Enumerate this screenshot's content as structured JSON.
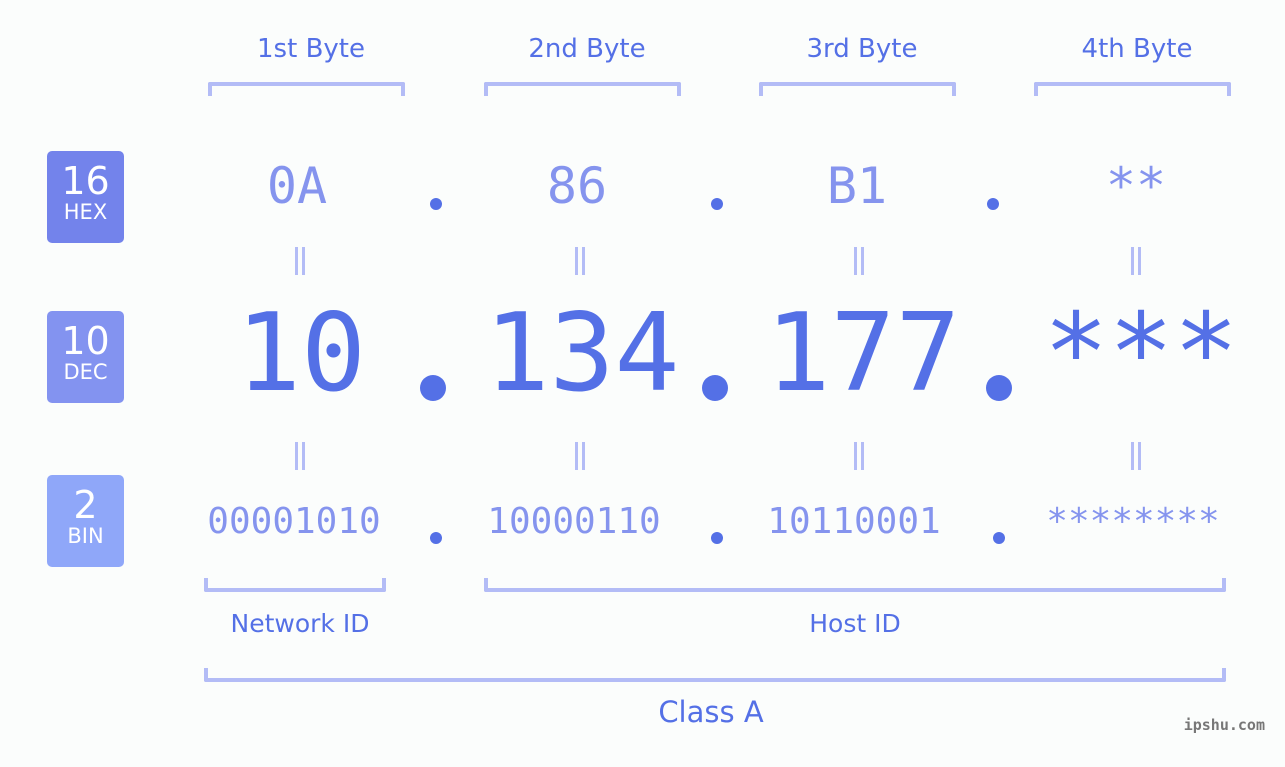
{
  "bytes": {
    "labels": [
      "1st Byte",
      "2nd Byte",
      "3rd Byte",
      "4th Byte"
    ]
  },
  "badges": {
    "hex": {
      "number": "16",
      "label": "HEX",
      "color": "#7383eb"
    },
    "dec": {
      "number": "10",
      "label": "DEC",
      "color": "#8393f0"
    },
    "bin": {
      "number": "2",
      "label": "BIN",
      "color": "#8fa7f9"
    }
  },
  "hex": [
    "0A",
    "86",
    "B1",
    "**"
  ],
  "dec": [
    "10",
    "134",
    "177",
    "***"
  ],
  "bin": [
    "00001010",
    "10000110",
    "10110001",
    "********"
  ],
  "sections": {
    "network_id": "Network ID",
    "host_id": "Host ID",
    "class": "Class A"
  },
  "colors": {
    "accent": "#5470e6",
    "light": "#8594ee",
    "bracket": "#b3bcf6"
  },
  "watermark": "ipshu.com"
}
